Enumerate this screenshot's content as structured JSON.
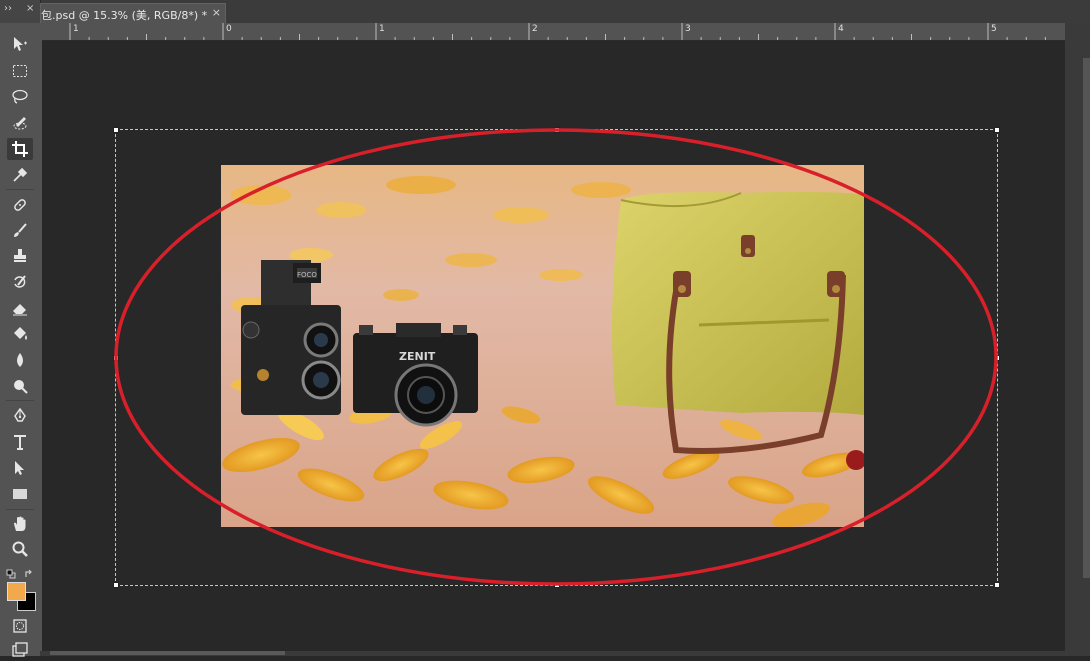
{
  "document_tab": {
    "title": "包.psd @ 15.3% (美, RGB/8*) *",
    "close": "×"
  },
  "panel_controls": {
    "collapse": "››",
    "close": "×"
  },
  "ruler": {
    "top_labels": [
      "1",
      "0",
      "1",
      "2",
      "3",
      "4",
      "5"
    ]
  },
  "photo_content": {
    "camera_brand_1": "ZENIT",
    "camera_brand_2": "FOCO"
  },
  "colors": {
    "foreground": "#f2a84c",
    "background": "#000000",
    "annotation": "#d9202a"
  }
}
